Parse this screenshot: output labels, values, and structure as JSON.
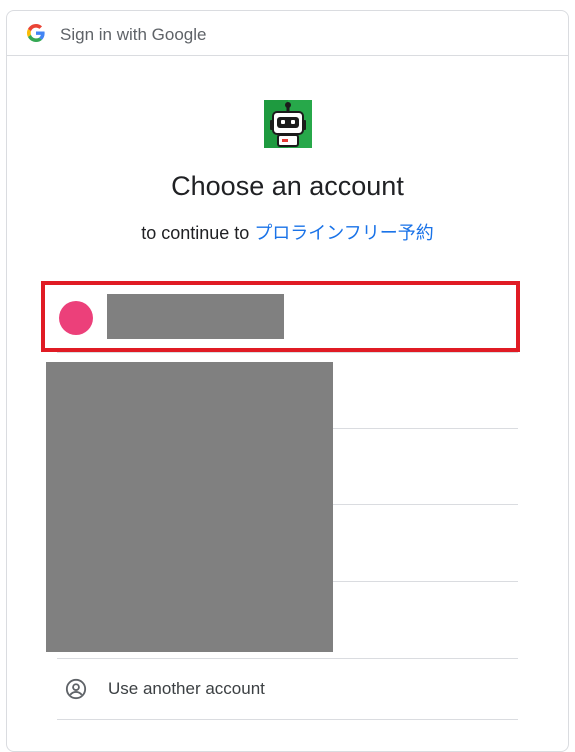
{
  "header": {
    "title": "Sign in with Google",
    "logo_icon": "google-g-icon"
  },
  "app": {
    "icon": "robot-app-icon"
  },
  "main": {
    "title": "Choose an account",
    "subtitle_prefix": "to continue to ",
    "app_name": "プロラインフリー予約"
  },
  "accounts": {
    "highlight_color": "#e01b24",
    "avatar_color": "#ec407a",
    "redaction_color": "#808080"
  },
  "use_another": {
    "label": "Use another account",
    "icon": "account-circle-icon"
  },
  "colors": {
    "link": "#1a73e8",
    "divider": "#dadce0"
  }
}
